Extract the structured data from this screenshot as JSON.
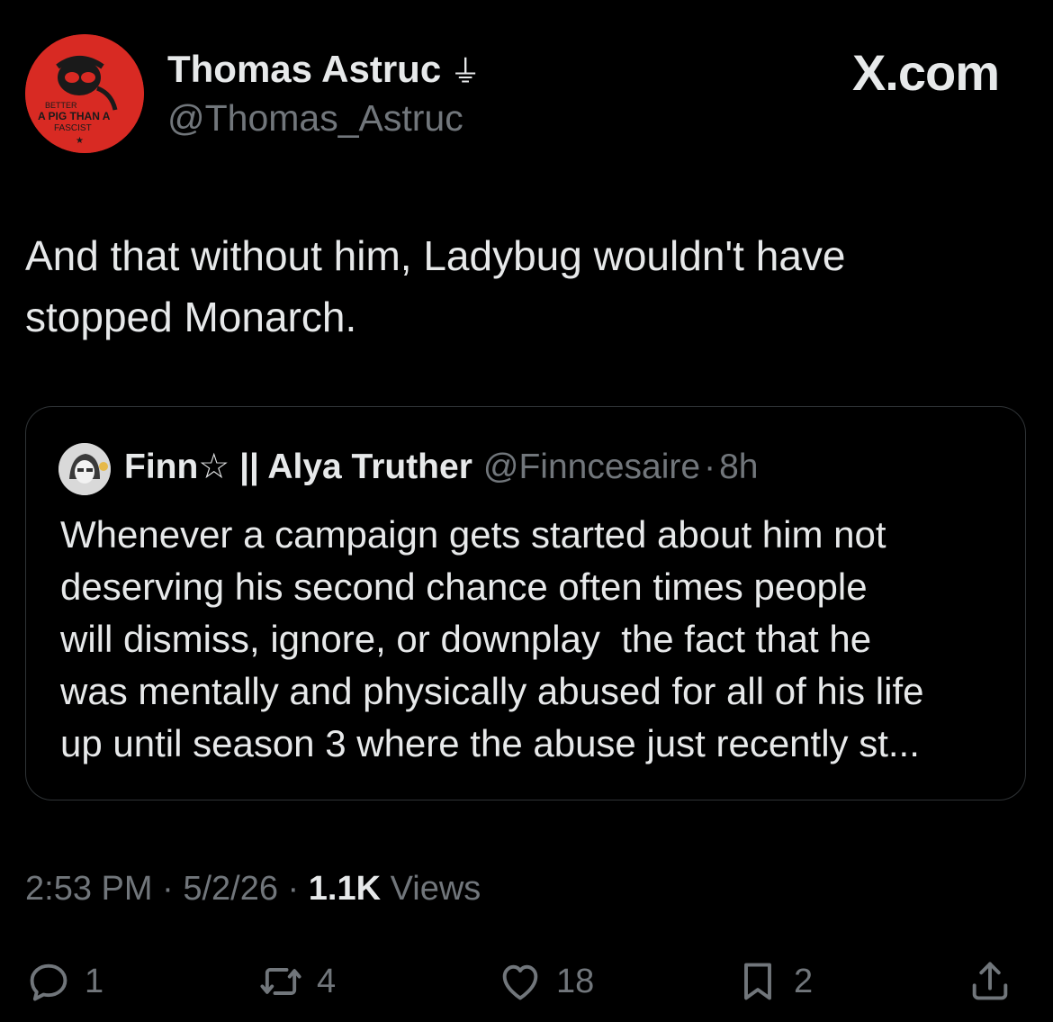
{
  "author": {
    "display_name": "Thomas Astruc",
    "badge": "⏚",
    "handle": "@Thomas_Astruc",
    "avatar_icon": "pig-aviator-avatar",
    "avatar_text": [
      "BETTER",
      "A PIG THAN A",
      "FASCIST",
      "★"
    ],
    "avatar_color": "#d82a23"
  },
  "brand": "X.com",
  "tweet": {
    "line1": "And that without him, Ladybug wouldn't have",
    "line2": "stopped Monarch."
  },
  "quote": {
    "display_name": "Finn☆ || Alya Truther",
    "handle": "@Finncesaire",
    "separator": "·",
    "time": "8h",
    "lines": [
      "Whenever a campaign gets started about him not",
      "deserving his second chance often times people",
      "will dismiss, ignore, or downplay  the fact that he",
      "was mentally and physically abused for all of his life",
      "up until season 3 where the abuse just recently st..."
    ]
  },
  "meta": {
    "time": "2:53 PM",
    "sep": "·",
    "date": "5/2/26",
    "views_count": "1.1K",
    "views_label": "Views"
  },
  "actions": {
    "reply_count": "1",
    "repost_count": "4",
    "like_count": "18",
    "bookmark_count": "2"
  },
  "colors": {
    "background": "#000000",
    "text": "#e7e9ea",
    "secondary": "#71767b",
    "border": "#2f3336"
  }
}
